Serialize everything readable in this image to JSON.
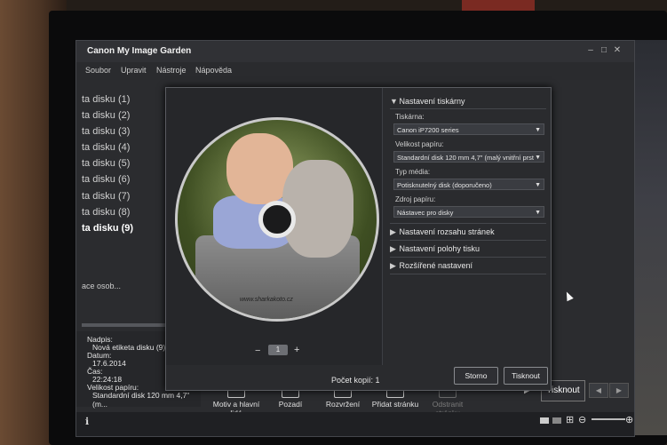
{
  "app": {
    "title": "Canon My Image Garden",
    "window_buttons": [
      "–",
      "□",
      "✕"
    ],
    "menu": [
      "Soubor",
      "Upravit",
      "Nástroje",
      "Nápověda"
    ]
  },
  "left_panel": {
    "items": [
      {
        "label": "ta disku (1)"
      },
      {
        "label": "ta disku (2)"
      },
      {
        "label": "ta disku (3)"
      },
      {
        "label": "ta disku (4)"
      },
      {
        "label": "ta disku (5)"
      },
      {
        "label": "ta disku (6)"
      },
      {
        "label": "ta disku (7)"
      },
      {
        "label": "ta disku (8)"
      },
      {
        "label": "ta disku (9)"
      }
    ],
    "persons_label": "ace osob..."
  },
  "info": {
    "title_label": "Nadpis:",
    "title_value": "Nová etiketa disku (9)",
    "date_label": "Datum:",
    "date_value": "17.6.2014",
    "time_label": "Čas:",
    "time_value": "22:24:18",
    "paper_label": "Velikost papíru:",
    "paper_value": "Standardní disk 120 mm 4,7\" (m..."
  },
  "toolbar": {
    "items": [
      {
        "label": "Motiv a hlavní lidé",
        "icon": "theme-icon"
      },
      {
        "label": "Pozadí",
        "icon": "background-icon"
      },
      {
        "label": "Rozvržení",
        "icon": "layout-icon"
      },
      {
        "label": "Přidat stránku",
        "icon": "add-page-icon"
      },
      {
        "label": "Odstranit stránku",
        "icon": "delete-page-icon"
      }
    ],
    "print_label": "Tisknout"
  },
  "dialog": {
    "disc_watermark": "www.sharkakoto.cz",
    "page_number": "1",
    "copies_label": "Počet kopií:",
    "copies_value": "1",
    "cancel_label": "Storno",
    "print_label": "Tisknout",
    "printer_section": {
      "title": "Nastavení tiskárny",
      "printer_label": "Tiskárna:",
      "printer_value": "Canon iP7200 series",
      "paper_size_label": "Velikost papíru:",
      "paper_size_value": "Standardní disk 120 mm 4,7\" (malý vnitřní prst",
      "media_type_label": "Typ média:",
      "media_type_value": "Potisknutelný disk (doporučeno)",
      "source_label": "Zdroj papíru:",
      "source_value": "Nástavec pro disky"
    },
    "sections": [
      {
        "label": "Nastavení rozsahu stránek"
      },
      {
        "label": "Nastavení polohy tisku"
      },
      {
        "label": "Rozšířené nastavení"
      }
    ]
  },
  "colors": {
    "window_bg": "#2b2c2f",
    "dialog_bg": "#2a2b2e",
    "text": "#d8d8d8"
  }
}
